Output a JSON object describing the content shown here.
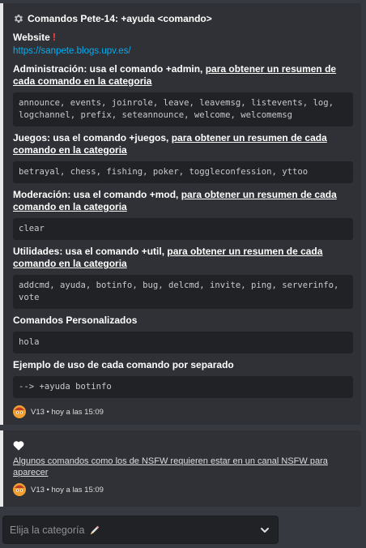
{
  "embed1": {
    "author": "Comandos Pete-14: +ayuda <comando>",
    "website_label": "Website",
    "website_mark": "!",
    "website_url": "https://sanpete.blogs.upv.es/",
    "sections": [
      {
        "name_plain": "Administración: usa el comando +admin, ",
        "name_link": "para obtener un resumen de cada comando en la categoria",
        "value": "announce, events, joinrole, leave, leavemsg, listevents, log, logchannel, prefix, seteannounce, welcome, welcomemsg"
      },
      {
        "name_plain": "Juegos: usa el comando +juegos, ",
        "name_link": "para obtener un resumen de cada comando en la categoria",
        "value": "betrayal, chess, fishing, poker, toggleconfession, yttoo"
      },
      {
        "name_plain": "Moderación: usa el comando +mod, ",
        "name_link": "para obtener un resumen de cada comando en la categoria",
        "value": "clear"
      },
      {
        "name_plain": "Utilidades: usa el comando +util, ",
        "name_link": "para obtener un resumen de cada comando en la categoria",
        "value": "addcmd, ayuda, botinfo, bug, delcmd, invite, ping, serverinfo, vote"
      },
      {
        "name_plain": "Comandos Personalizados",
        "name_link": "",
        "value": "hola"
      },
      {
        "name_plain": "Ejemplo de uso de cada comando por separado",
        "name_link": "",
        "value": "--> +ayuda botinfo"
      }
    ],
    "footer": "V13 • hoy a las 15:09"
  },
  "embed2": {
    "text": "Algunos comandos como los de NSFW requieren estar en un canal NSFW para aparecer",
    "footer": "V13 • hoy a las 15:09"
  },
  "select": {
    "placeholder": "Elija la categoría"
  },
  "icons": {
    "author": "gear-icon",
    "footer": "bot-avatar-icon",
    "embed2": "heart-icon",
    "select_emoji": "pencil-icon",
    "select_toggle": "chevron-down-icon"
  },
  "colors": {
    "background": "#36393f",
    "embed_bg": "#2f3136",
    "embed_border": "#e8e8e8",
    "code_bg": "#202225",
    "link": "#00aff4",
    "mark": "#ed4245"
  }
}
